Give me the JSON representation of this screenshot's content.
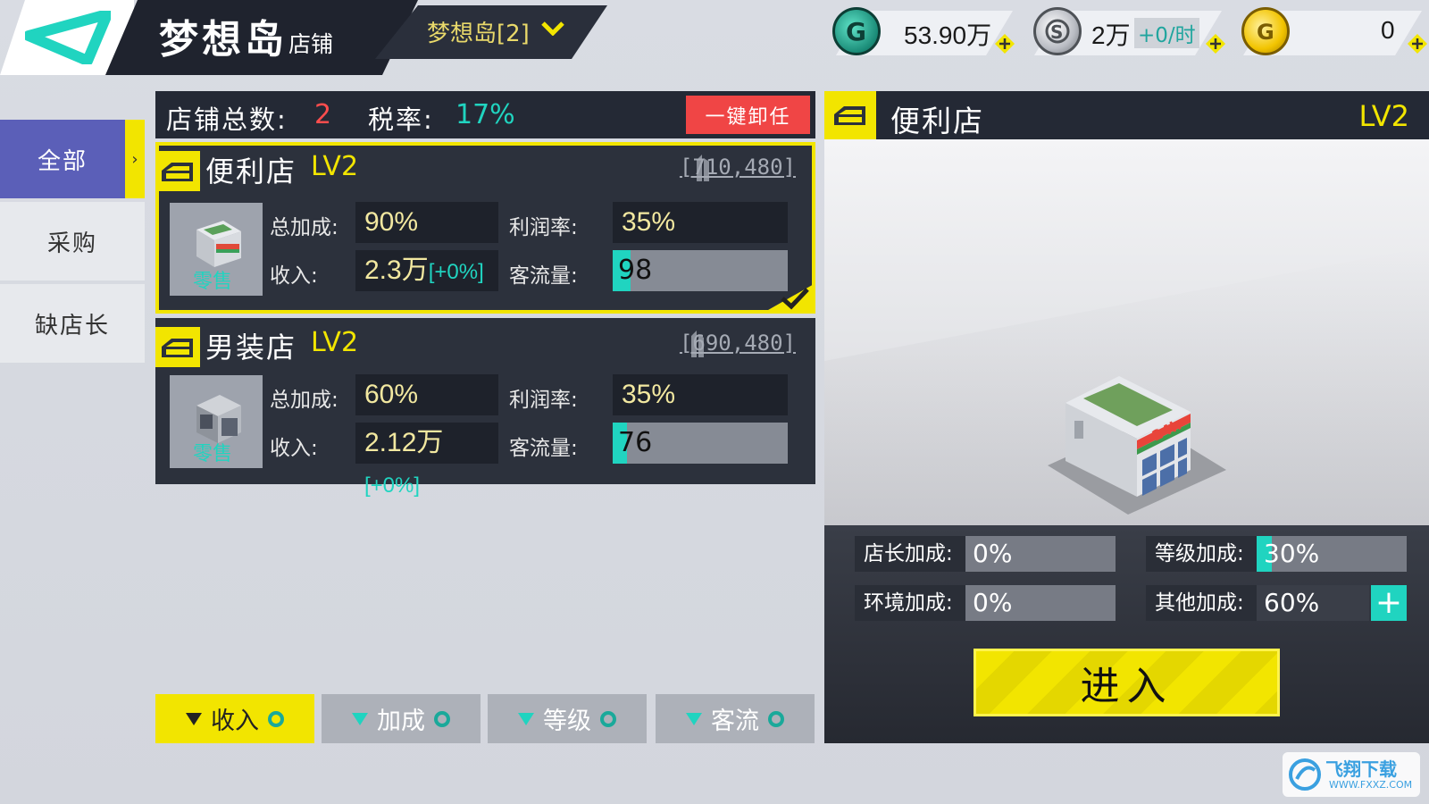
{
  "header": {
    "title_main": "梦想岛",
    "title_sub": "店铺",
    "island_selector": "梦想岛[2]"
  },
  "currencies": [
    {
      "icon": "green-g-coin-icon",
      "value": "53.90万",
      "rate": ""
    },
    {
      "icon": "silver-coin-icon",
      "value": "2万",
      "rate": "+0/时"
    },
    {
      "icon": "gold-coin-icon",
      "value": "0",
      "rate": ""
    }
  ],
  "sidebar": {
    "items": [
      {
        "label": "全部"
      },
      {
        "label": "采购"
      },
      {
        "label": "缺店长"
      }
    ]
  },
  "list_header": {
    "count_label": "店铺总数:",
    "count_value": "2",
    "tax_label": "税率:",
    "tax_value": "17%",
    "dismiss_all": "一键卸任"
  },
  "shops": [
    {
      "name": "便利店",
      "level": "LV2",
      "coords": "[710,480]",
      "category": "零售",
      "total_bonus_label": "总加成:",
      "total_bonus": "90%",
      "profit_label": "利润率:",
      "profit": "35%",
      "income_label": "收入:",
      "income": "2.3万",
      "income_delta": "[+0%]",
      "traffic_label": "客流量:",
      "traffic": "98",
      "traffic_fraction": 0.1
    },
    {
      "name": "男装店",
      "level": "LV2",
      "coords": "[690,480]",
      "category": "零售",
      "total_bonus_label": "总加成:",
      "total_bonus": "60%",
      "profit_label": "利润率:",
      "profit": "35%",
      "income_label": "收入:",
      "income": "2.12万",
      "income_delta": "[+0%]",
      "traffic_label": "客流量:",
      "traffic": "76",
      "traffic_fraction": 0.08
    }
  ],
  "sort_buttons": [
    {
      "label": "收入"
    },
    {
      "label": "加成"
    },
    {
      "label": "等级"
    },
    {
      "label": "客流"
    }
  ],
  "detail": {
    "name": "便利店",
    "level": "LV2",
    "manager_bonus_label": "店长加成:",
    "manager_bonus": "0%",
    "level_bonus_label": "等级加成:",
    "level_bonus": "30%",
    "level_bonus_fraction": 0.1,
    "env_bonus_label": "环境加成:",
    "env_bonus": "0%",
    "other_bonus_label": "其他加成:",
    "other_bonus": "60%",
    "enter_label": "进入",
    "building_sign": "24h"
  },
  "watermark": {
    "text": "飞翔下载",
    "url": "WWW.FXXZ.COM"
  },
  "colors": {
    "accent_yellow": "#f2e500",
    "accent_teal": "#20d4c0",
    "danger_red": "#f04545",
    "panel_dark": "#2c313c"
  }
}
